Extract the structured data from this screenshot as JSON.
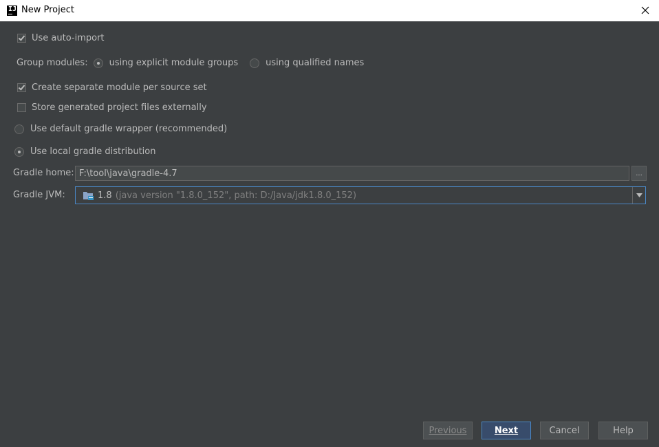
{
  "window": {
    "title": "New Project"
  },
  "options": {
    "auto_import": {
      "label": "Use auto-import",
      "checked": true
    },
    "group_modules": {
      "label": "Group modules:",
      "choices": [
        {
          "label": "using explicit module groups",
          "selected": true
        },
        {
          "label": "using qualified names",
          "selected": false
        }
      ]
    },
    "separate_module": {
      "label": "Create separate module per source set",
      "checked": true
    },
    "store_externally": {
      "label": "Store generated project files externally",
      "checked": false
    },
    "gradle_wrapper": {
      "label": "Use default gradle wrapper (recommended)",
      "selected": false
    },
    "local_gradle": {
      "label": "Use local gradle distribution",
      "selected": true
    }
  },
  "gradle_home": {
    "label": "Gradle home:",
    "value": "F:\\tool\\java\\gradle-4.7",
    "browse_label": "..."
  },
  "gradle_jvm": {
    "label": "Gradle JVM:",
    "version": "1.8",
    "detail": "(java version \"1.8.0_152\", path: D:/Java/jdk1.8.0_152)"
  },
  "buttons": {
    "previous": "Previous",
    "next": "Next",
    "cancel": "Cancel",
    "help": "Help"
  },
  "colors": {
    "background": "#3c3f41",
    "accent": "#4a88c7",
    "default_button": "#384c6b"
  }
}
